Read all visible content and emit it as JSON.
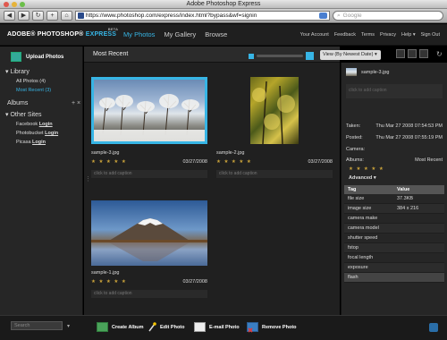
{
  "window": {
    "title": "Adobe Photoshop Express"
  },
  "browser": {
    "back": "◀",
    "forward": "▶",
    "reload": "↻",
    "add": "+",
    "home": "⌂",
    "url": "https://www.photoshop.com/express/index.html?bypass&wf=signin",
    "search_placeholder": "Google"
  },
  "app": {
    "logo_main": "ADOBE® PHOTOSHOP®",
    "logo_express": "EXPRESS",
    "logo_beta": "BETA",
    "nav": [
      "My Photos",
      "My Gallery",
      "Browse"
    ],
    "user_nav": [
      "Your Account",
      "Feedback",
      "Terms",
      "Privacy",
      "Help ▾",
      "Sign Out"
    ]
  },
  "sidebar": {
    "upload": "Upload Photos",
    "library": "▾ Library",
    "library_items": [
      "All Photos (4)",
      "Most Recent (3)"
    ],
    "albums": "Albums",
    "albums_ctrls": "+ ×",
    "other_sites": "▾ Other Sites",
    "sites": [
      {
        "name": "Facebook",
        "action": "Login"
      },
      {
        "name": "Photobucket",
        "action": "Login"
      },
      {
        "name": "Picasa",
        "action": "Login"
      }
    ],
    "search_placeholder": "Search",
    "search_arrow": "▾"
  },
  "main": {
    "title": "Most Recent",
    "view_select": "View (By Newest Date)  ▾",
    "divider_handle": "⋮",
    "photos": [
      {
        "name": "sample-3.jpg",
        "date": "03/27/2008",
        "stars": "★ ★ ★ ★ ★",
        "caption": "click to add caption"
      },
      {
        "name": "sample-2.jpg",
        "date": "03/27/2008",
        "stars": "★ ★ ★ ★ ★",
        "caption": "click to add caption"
      },
      {
        "name": "sample-1.jpg",
        "date": "03/27/2008",
        "stars": "★ ★ ★ ★ ★",
        "caption": "click to add caption"
      }
    ]
  },
  "panel": {
    "name": "sample-3.jpg",
    "caption_placeholder": "click to add caption",
    "meta": [
      {
        "k": "Taken:",
        "v": "Thu Mar 27 2008 07:54:53 PM"
      },
      {
        "k": "Posted:",
        "v": "Thu Mar 27 2008 07:55:19 PM"
      },
      {
        "k": "Camera:",
        "v": ""
      },
      {
        "k": "Albums:",
        "v": "Most Recent"
      }
    ],
    "stars": "★ ★ ★ ★ ★",
    "advanced": "Advanced  ▾",
    "table_headers": [
      "Tag",
      "Value"
    ],
    "table_rows": [
      {
        "tag": "file size",
        "value": "37.3KB"
      },
      {
        "tag": "image size",
        "value": "384 x 216"
      },
      {
        "tag": "camera make",
        "value": ""
      },
      {
        "tag": "camera model",
        "value": ""
      },
      {
        "tag": "shutter speed",
        "value": ""
      },
      {
        "tag": "fstop",
        "value": ""
      },
      {
        "tag": "focal length",
        "value": ""
      },
      {
        "tag": "exposure",
        "value": ""
      },
      {
        "tag": "flash",
        "value": ""
      }
    ]
  },
  "actions": [
    "Create Album",
    "Edit Photo",
    "E-mail Photo",
    "Remove Photo"
  ],
  "colors": {
    "accent": "#37b5e5",
    "star": "#c9a23a"
  }
}
